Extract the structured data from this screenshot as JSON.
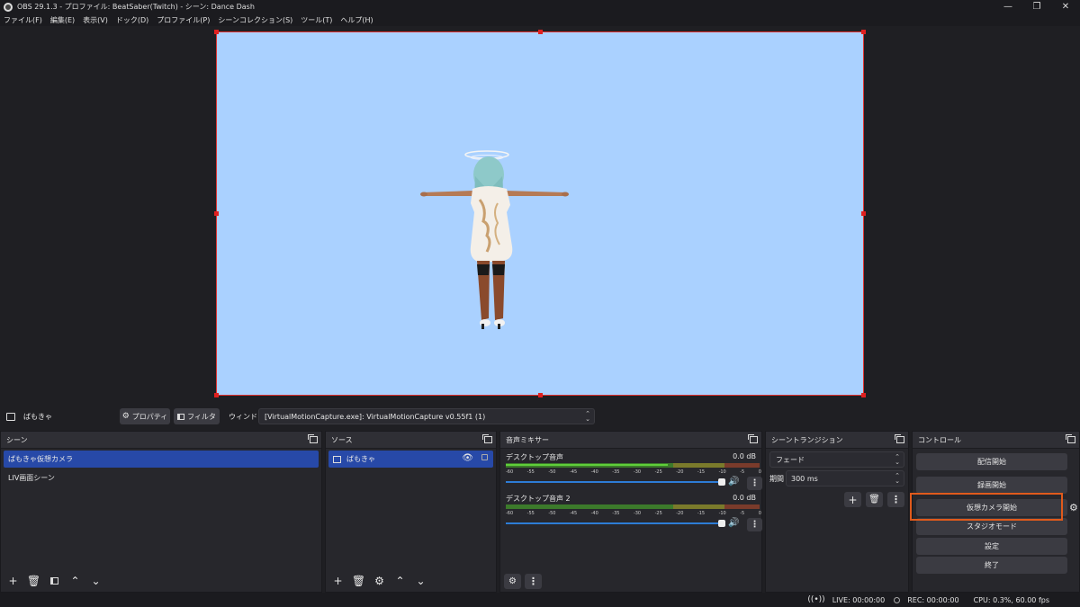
{
  "window": {
    "title": "OBS 29.1.3 - プロファイル: BeatSaber(Twitch) - シーン: Dance Dash",
    "minimize": "—",
    "maximize": "❐",
    "close": "✕"
  },
  "menu": [
    "ファイル(F)",
    "編集(E)",
    "表示(V)",
    "ドック(D)",
    "プロファイル(P)",
    "シーンコレクション(S)",
    "ツール(T)",
    "ヘルプ(H)"
  ],
  "source_toolbar": {
    "source_name": "ばもきゃ",
    "properties_label": "プロパティ",
    "filters_label": "フィルタ",
    "window_label": "ウィンドウ",
    "window_value": "[VirtualMotionCapture.exe]: VirtualMotionCapture v0.55f1 (1)"
  },
  "scenes": {
    "title": "シーン",
    "items": [
      "ばもきゃ仮想カメラ",
      "LIV画面シーン"
    ],
    "selected_index": 0
  },
  "sources": {
    "title": "ソース",
    "items": [
      "ばもきゃ"
    ]
  },
  "mixer": {
    "title": "音声ミキサー",
    "tracks": [
      {
        "name": "デスクトップ音声",
        "db": "0.0 dB"
      },
      {
        "name": "デスクトップ音声 2",
        "db": "0.0 dB"
      }
    ],
    "ticks": [
      "-60",
      "-55",
      "-50",
      "-45",
      "-40",
      "-35",
      "-30",
      "-25",
      "-20",
      "-15",
      "-10",
      "-5",
      "0"
    ]
  },
  "transitions": {
    "title": "シーントランジション",
    "type": "フェード",
    "duration_label": "期間",
    "duration_value": "300 ms"
  },
  "controls": {
    "title": "コントロール",
    "start_streaming": "配信開始",
    "start_recording": "録画開始",
    "start_virtual_camera": "仮想カメラ開始",
    "studio_mode": "スタジオモード",
    "settings": "設定",
    "exit": "終了"
  },
  "status": {
    "live": "LIVE: 00:00:00",
    "rec": "REC: 00:00:00",
    "cpu": "CPU: 0.3%, 60.00 fps"
  },
  "colors": {
    "canvas_bg": "#aad1ff",
    "selection_border": "#e03030",
    "selected_scene": "#2749a8",
    "highlight_box": "#e05a1c"
  }
}
